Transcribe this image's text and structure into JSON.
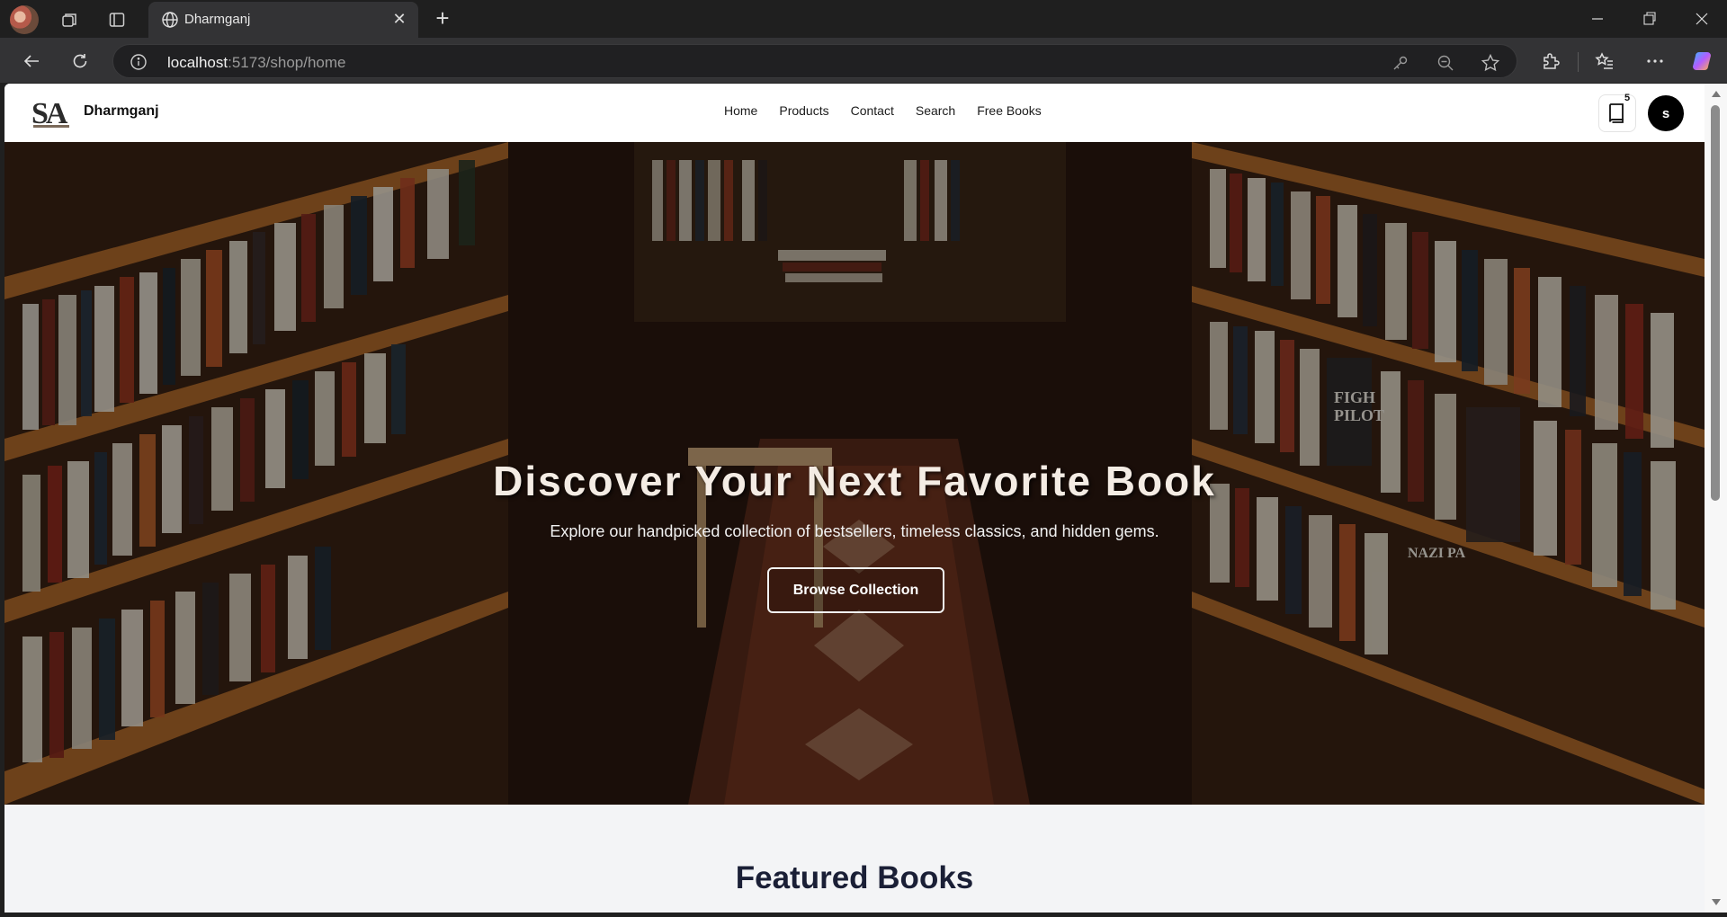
{
  "browser": {
    "tab_title": "Dharmganj",
    "url_host": "localhost",
    "url_path": ":5173/shop/home"
  },
  "site": {
    "brand": "Dharmganj",
    "logo_text": "SA",
    "nav": [
      "Home",
      "Products",
      "Contact",
      "Search",
      "Free Books"
    ],
    "cart_count": "5",
    "avatar_initial": "s"
  },
  "hero": {
    "title": "Discover Your Next Favorite Book",
    "subtitle": "Explore our handpicked collection of bestsellers, timeless classics, and hidden gems.",
    "cta": "Browse Collection"
  },
  "featured": {
    "heading": "Featured Books"
  }
}
